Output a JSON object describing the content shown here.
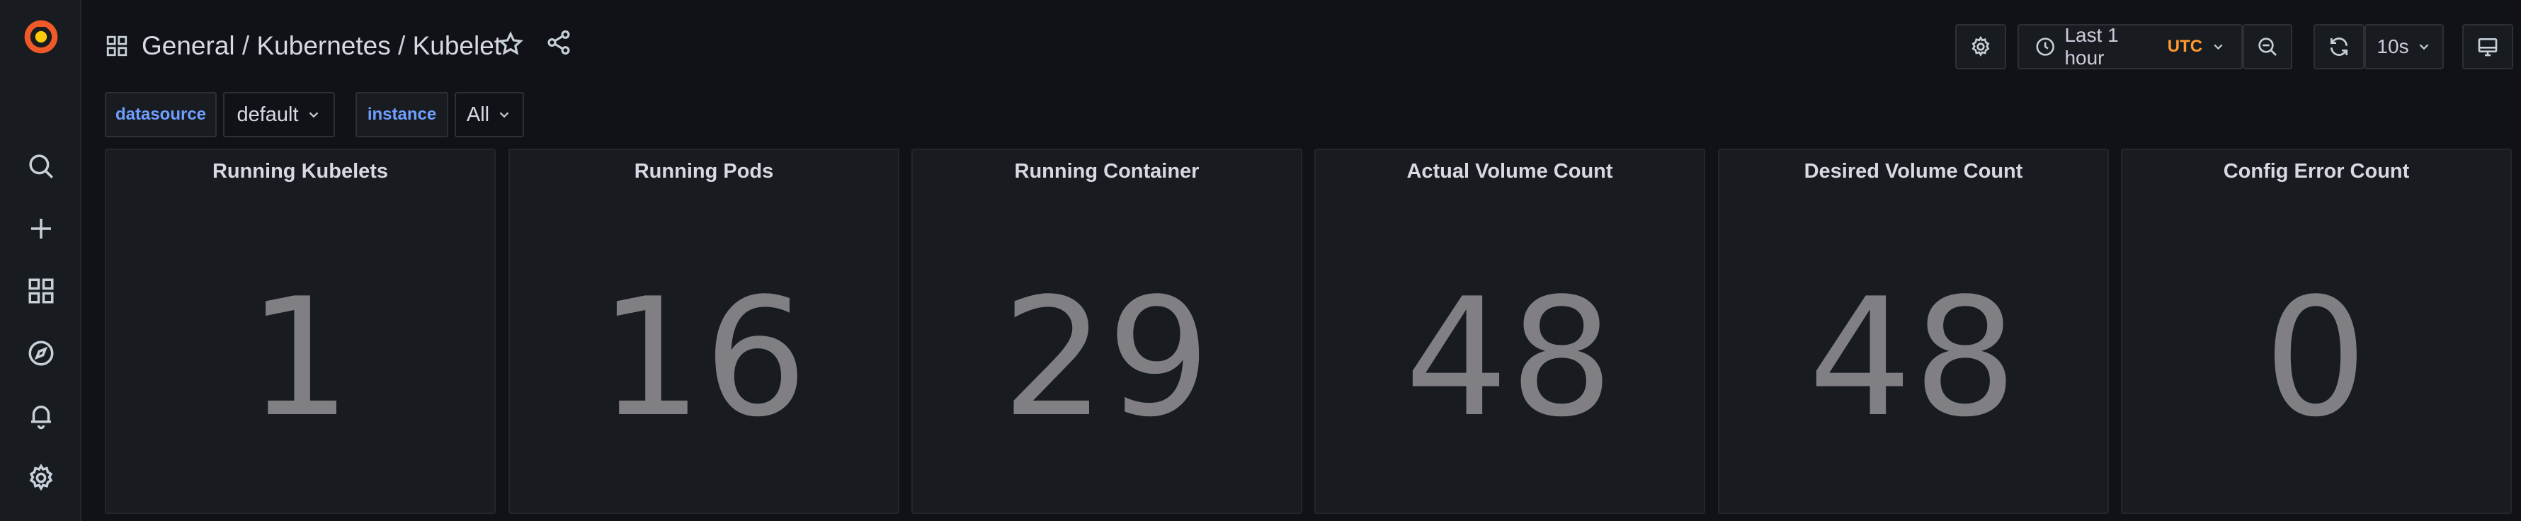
{
  "breadcrumb": {
    "folder": "General",
    "separator_1": " / ",
    "section": "Kubernetes",
    "separator_2": " / ",
    "dashboard": "Kubelet"
  },
  "toolbar": {
    "time_range": "Last 1 hour",
    "timezone": "UTC",
    "refresh_interval": "10s"
  },
  "variables": [
    {
      "label": "datasource",
      "value": "default"
    },
    {
      "label": "instance",
      "value": "All"
    }
  ],
  "panels": [
    {
      "title": "Running Kubelets",
      "value": "1"
    },
    {
      "title": "Running Pods",
      "value": "16"
    },
    {
      "title": "Running Container",
      "value": "29"
    },
    {
      "title": "Actual Volume Count",
      "value": "48"
    },
    {
      "title": "Desired Volume Count",
      "value": "48"
    },
    {
      "title": "Config Error Count",
      "value": "0"
    }
  ],
  "colors": {
    "background": "#111217",
    "panel": "#181b1f",
    "accent_orange": "#ff9830",
    "variable_label": "#6e9fff",
    "stat_value": "#7f7f84"
  },
  "icons": {
    "sidebar": [
      "grafana-logo",
      "search-icon",
      "plus-icon",
      "dashboards-icon",
      "explore-icon",
      "alerting-icon",
      "settings-icon"
    ],
    "toolbar": [
      "dashboard-grid-icon",
      "star-icon",
      "share-icon",
      "dashboard-settings-icon",
      "clock-icon",
      "zoom-out-icon",
      "refresh-icon",
      "tv-mode-icon"
    ]
  }
}
